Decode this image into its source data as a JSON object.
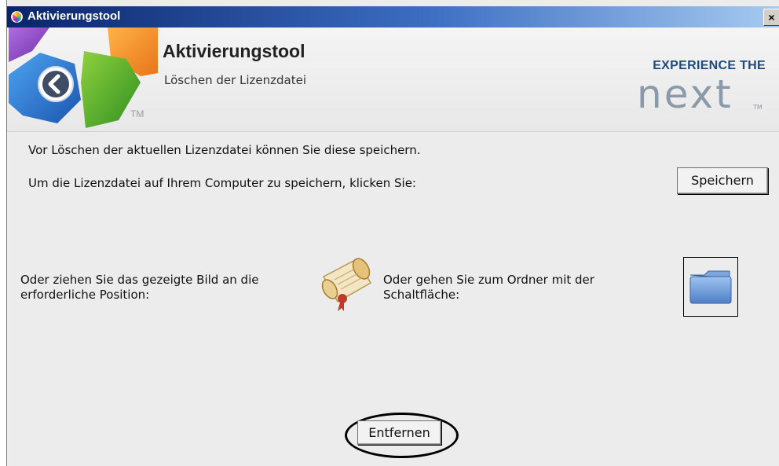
{
  "window": {
    "title": "Aktivierungstool",
    "close_glyph": "×"
  },
  "header": {
    "title": "Aktivierungstool",
    "subtitle": "Löschen der Lizenzdatei",
    "tm": "TM",
    "brand_line1": "EXPERIENCE THE",
    "brand_line2": "next",
    "brand_color": "#1e4a7a",
    "brand_next_color": "#8a9aa8"
  },
  "main": {
    "intro": "Vor Löschen der aktuellen Lizenzdatei können Sie diese speichern.",
    "save_prompt": "Um die Lizenzdatei auf Ihrem Computer zu speichern, klicken Sie:",
    "save_button": "Speichern",
    "drag_text_line1": "Oder ziehen Sie das gezeigte Bild an die",
    "drag_text_line2": "erforderliche Position:",
    "folder_text_line1": "Oder gehen Sie zum Ordner mit der",
    "folder_text_line2": "Schaltfläche:",
    "remove_button": "Entfernen"
  },
  "icons": {
    "app": "app-logo-icon",
    "back": "back-arrow-icon",
    "license_scroll": "license-scroll-icon",
    "folder": "folder-icon"
  }
}
